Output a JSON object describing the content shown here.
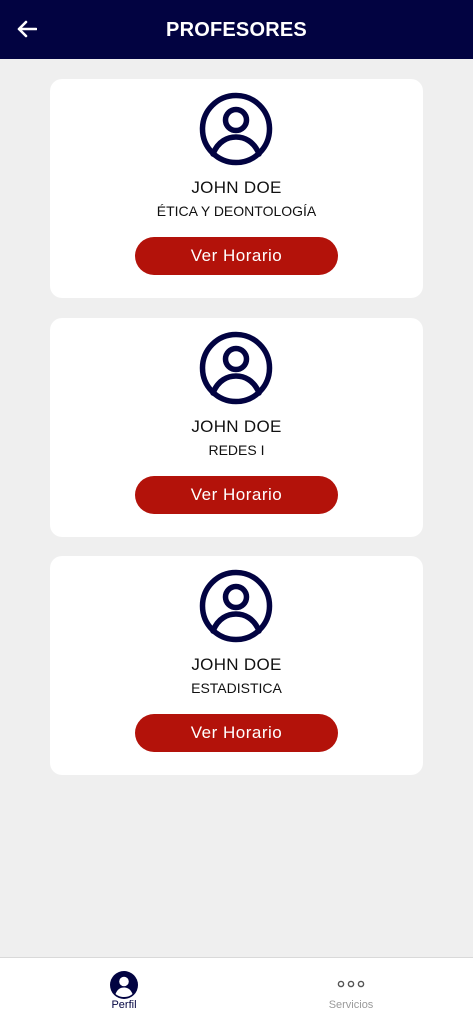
{
  "header": {
    "title": "PROFESORES",
    "back_icon": "arrow-left-icon"
  },
  "colors": {
    "header_bg": "#020341",
    "accent_red": "#b3120a",
    "background": "#efefef",
    "card_bg": "#ffffff"
  },
  "professors": [
    {
      "name": "JOHN DOE",
      "course": "ÉTICA Y DEONTOLOGÍA",
      "button_label": "Ver Horario",
      "avatar_icon": "user-circle-icon"
    },
    {
      "name": "JOHN DOE",
      "course": "REDES I",
      "button_label": "Ver Horario",
      "avatar_icon": "user-circle-icon"
    },
    {
      "name": "JOHN DOE",
      "course": "ESTADISTICA",
      "button_label": "Ver Horario",
      "avatar_icon": "user-circle-icon"
    }
  ],
  "bottom_nav": {
    "items": [
      {
        "label": "Perfil",
        "icon": "user-filled-icon",
        "active": true
      },
      {
        "label": "Servicios",
        "icon": "more-dots-icon",
        "active": false
      }
    ]
  }
}
